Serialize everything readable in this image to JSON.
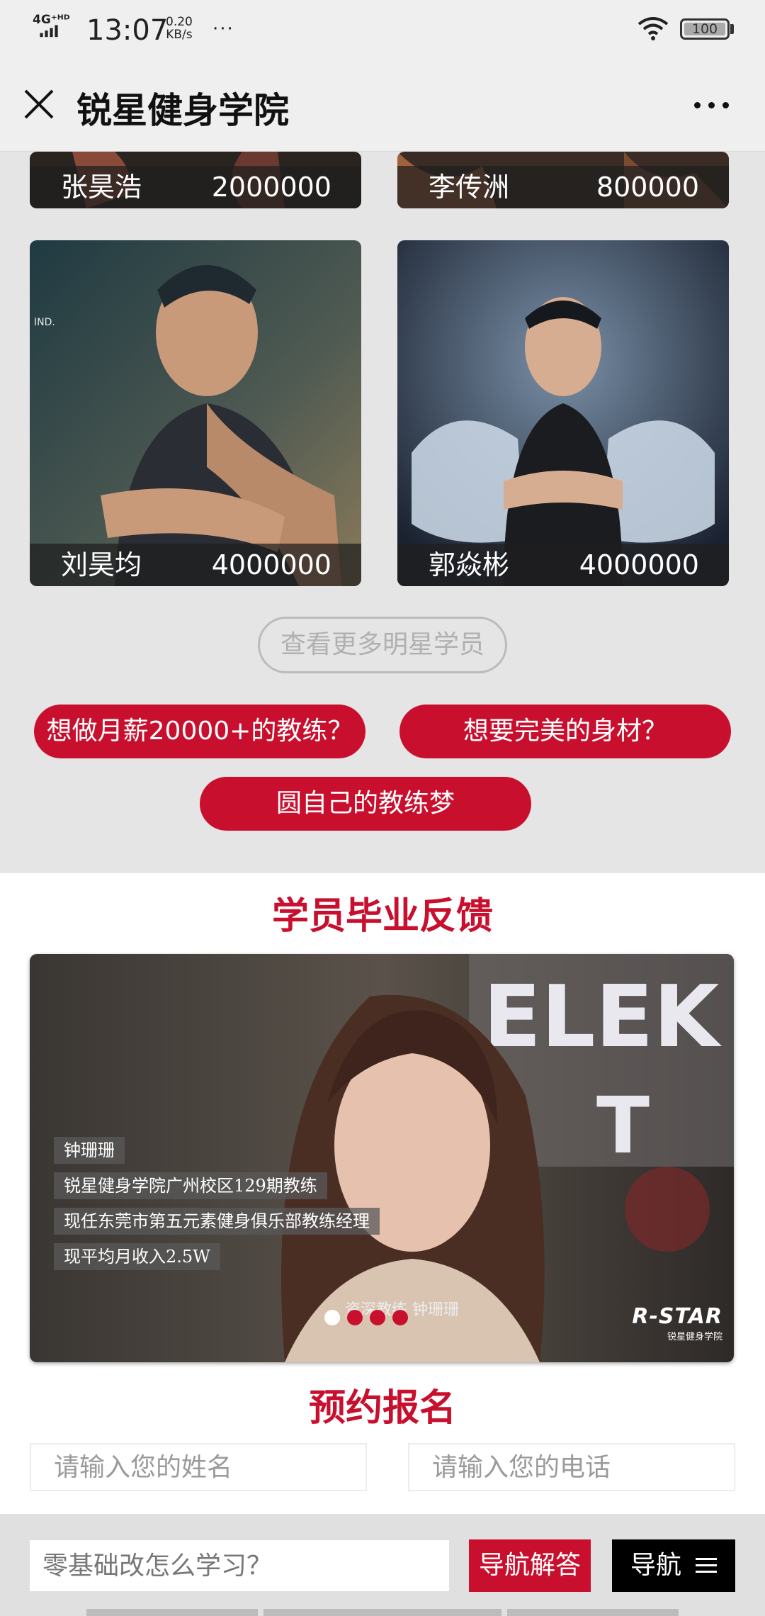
{
  "status_bar": {
    "network": "4G⁺ᴴᴰ",
    "time": "13:07",
    "speed_value": "0.20",
    "speed_unit": "KB/s",
    "more": "···",
    "battery": "100"
  },
  "title_bar": {
    "title": "锐星健身学院",
    "close_icon": "close-icon",
    "more_icon": "more-icon"
  },
  "students": [
    {
      "name": "张昊浩",
      "salary": "2000000"
    },
    {
      "name": "李传洲",
      "salary": "800000"
    },
    {
      "name": "刘昊均",
      "salary": "4000000"
    },
    {
      "name": "郭焱彬",
      "salary": "4000000"
    }
  ],
  "more_students_label": "查看更多明星学员",
  "cta_buttons": [
    "想做月薪20000+的教练？",
    "想要完美的身材？",
    "圆自己的教练梦"
  ],
  "feedback": {
    "title": "学员毕业反馈",
    "subtitles": [
      "钟珊珊",
      "锐星健身学院广州校区129期教练",
      "现任东莞市第五元素健身俱乐部教练经理",
      "现平均月收入2.5W"
    ],
    "caption": "资深教练 钟珊珊",
    "logo_text": "R-STAR",
    "logo_sub": "锐星健身学院",
    "carousel_total": 4,
    "carousel_active": 1
  },
  "signup": {
    "title": "预约报名",
    "name_placeholder": "请输入您的姓名",
    "phone_placeholder": "请输入您的电话"
  },
  "bottom_bar": {
    "question_placeholder": "零基础改怎么学习？",
    "nav_answer_label": "导航解答",
    "nav_label": "导航"
  },
  "colors": {
    "accent": "#c8102e",
    "page_bg": "#e5e5e5"
  }
}
